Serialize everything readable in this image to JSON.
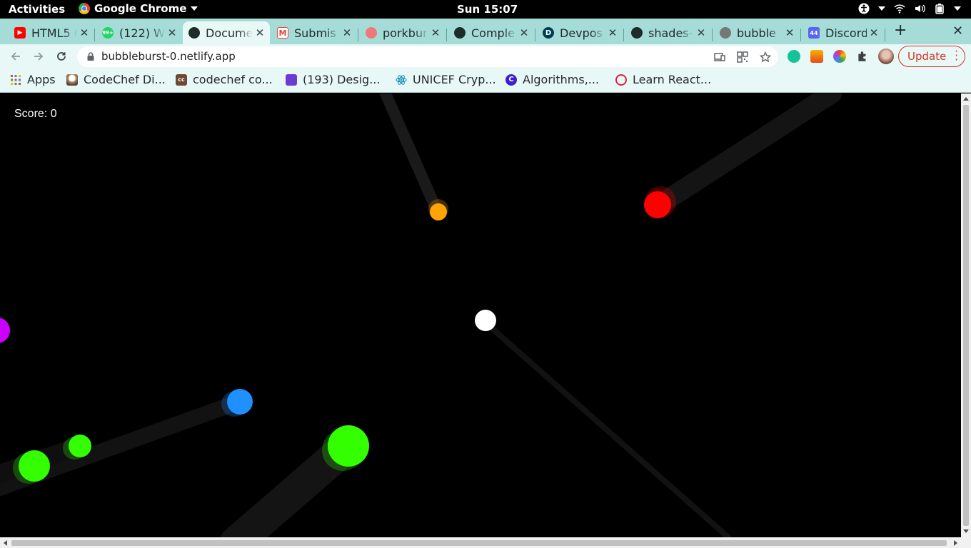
{
  "topbar": {
    "activities": "Activities",
    "app_name": "Google Chrome",
    "clock": "Sun 15:07"
  },
  "tabs": [
    {
      "title": "HTML5 G",
      "favicon": "youtube-icon",
      "color": "#ff0000",
      "badge": ""
    },
    {
      "title": "(122) W",
      "favicon": "whatsapp-icon",
      "color": "#25d366",
      "badge": "99+"
    },
    {
      "title": "Docume",
      "favicon": "globe-icon",
      "color": "#1f2a2a",
      "badge": "",
      "active": true
    },
    {
      "title": "Submis",
      "favicon": "gmail-icon",
      "color": "#ea4335",
      "badge": ""
    },
    {
      "title": "porkbun",
      "favicon": "porkbun-icon",
      "color": "#ef7878",
      "badge": ""
    },
    {
      "title": "Comple",
      "favicon": "github-icon",
      "color": "#1f2a2a",
      "badge": ""
    },
    {
      "title": "Devpos",
      "favicon": "devpost-icon",
      "color": "#003e54",
      "badge": "D"
    },
    {
      "title": "shades-",
      "favicon": "github-icon",
      "color": "#1f2a2a",
      "badge": ""
    },
    {
      "title": "bubble",
      "favicon": "globe-icon",
      "color": "#777777",
      "badge": ""
    },
    {
      "title": "Discord",
      "favicon": "discord-icon",
      "color": "#5865f2",
      "badge": "44"
    }
  ],
  "toolbar": {
    "url": "bubbleburst-0.netlify.app",
    "update_label": "Update"
  },
  "bookmarks": [
    {
      "label": "Apps",
      "icon": "apps-grid-icon",
      "color": "#4285f4"
    },
    {
      "label": "CodeChef Di...",
      "icon": "codechef-icon",
      "color": "#5b4638"
    },
    {
      "label": "codechef co...",
      "icon": "codechef-cc-icon",
      "color": "#6b4a2f"
    },
    {
      "label": "(193) Desig...",
      "icon": "notification-icon",
      "color": "#6c3bd1"
    },
    {
      "label": "UNICEF Cryp...",
      "icon": "react-icon",
      "color": "#1e8bc3"
    },
    {
      "label": "Algorithms,...",
      "icon": "c-logo-icon",
      "color": "#3b1fd0"
    },
    {
      "label": "Learn React...",
      "icon": "scrimba-icon",
      "color": "#e11d48"
    }
  ],
  "game": {
    "score_text": "Score: 0",
    "player_color": "#ffffff",
    "enemy_colors": [
      "#ffa500",
      "#ff0000",
      "#cc00ff",
      "#1e90ff",
      "#33ff00"
    ]
  }
}
